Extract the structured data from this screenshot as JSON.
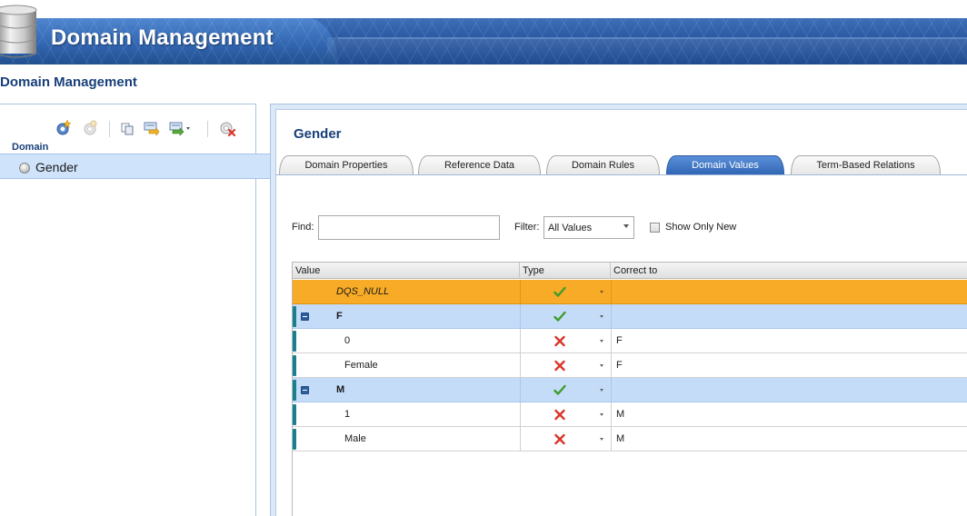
{
  "app": {
    "title": "Domain Management"
  },
  "page": {
    "heading": "Domain Management"
  },
  "left_panel": {
    "toolbar_icons": [
      "create-domain-icon",
      "reference-icon",
      "copy-icon",
      "import-icon",
      "export-icon",
      "delete-domain-icon"
    ],
    "column_label": "Domain",
    "domains": [
      {
        "label": "Gender",
        "selected": true
      }
    ]
  },
  "domain": {
    "title": "Gender",
    "tabs": [
      {
        "label": "Domain Properties",
        "active": false
      },
      {
        "label": "Reference Data",
        "active": false
      },
      {
        "label": "Domain Rules",
        "active": false
      },
      {
        "label": "Domain Values",
        "active": true
      },
      {
        "label": "Term-Based Relations",
        "active": false
      }
    ],
    "find": {
      "label": "Find:",
      "value": ""
    },
    "filter": {
      "label": "Filter:",
      "value": "All Values"
    },
    "show_only_new": {
      "label": "Show Only New",
      "checked": false
    },
    "grid": {
      "columns": [
        "Value",
        "Type",
        "Correct to"
      ],
      "rows": [
        {
          "value": "DQS_NULL",
          "type": "correct",
          "correct_to": "",
          "style": "selected",
          "italic": true
        },
        {
          "value": "F",
          "type": "correct",
          "correct_to": "",
          "style": "group"
        },
        {
          "value": "0",
          "type": "error",
          "correct_to": "F",
          "style": "child"
        },
        {
          "value": "Female",
          "type": "error",
          "correct_to": "F",
          "style": "child"
        },
        {
          "value": "M",
          "type": "correct",
          "correct_to": "",
          "style": "group"
        },
        {
          "value": "1",
          "type": "error",
          "correct_to": "M",
          "style": "child"
        },
        {
          "value": "Male",
          "type": "error",
          "correct_to": "M",
          "style": "child"
        }
      ]
    }
  },
  "colors": {
    "banner_blue": "#2c5aa3",
    "heading_blue": "#183f7a",
    "selected_row": "#f8ab26",
    "group_row": "#c4dcf8",
    "active_tab": "#2f64b4",
    "correct_check": "#3f9c2c",
    "error_x": "#d8352a"
  }
}
